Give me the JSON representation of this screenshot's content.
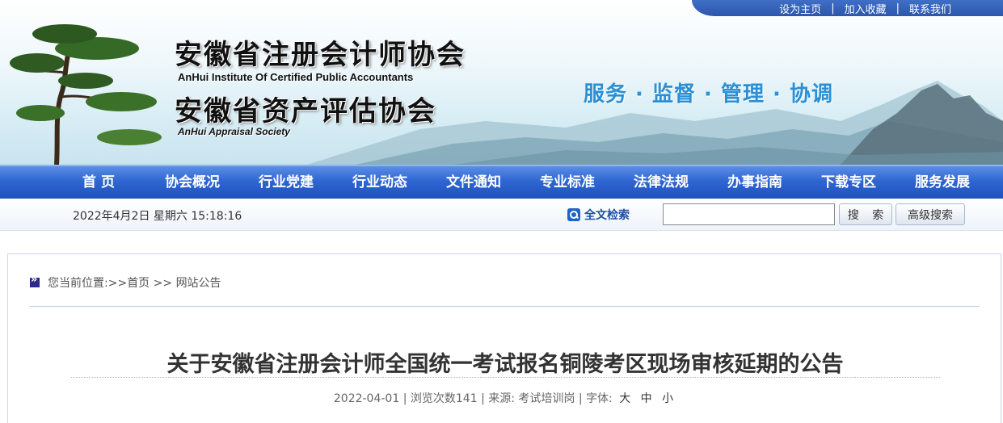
{
  "top_links": [
    "设为主页",
    "加入收藏",
    "联系我们"
  ],
  "banner": {
    "org_cn_1": "安徽省注册会计师协会",
    "org_en_1": "AnHui Institute Of Certified Public Accountants",
    "org_cn_2": "安徽省资产评估协会",
    "org_en_2": "AnHui Appraisal Society",
    "slogan": "服务 · 监督 · 管理 · 协调"
  },
  "nav": [
    "首 页",
    "协会概况",
    "行业党建",
    "行业动态",
    "文件通知",
    "专业标准",
    "法律法规",
    "办事指南",
    "下载专区",
    "服务发展"
  ],
  "infobar": {
    "datetime": "2022年4月2日 星期六 15:18:16",
    "fulltext_label": "全文检索",
    "search_value": "",
    "search_button": "搜 索",
    "advanced_button": "高级搜索"
  },
  "breadcrumb": {
    "prefix": "您当前位置:>>",
    "home": "首页",
    "separator": ">>",
    "current": "网站公告"
  },
  "article": {
    "title": "关于安徽省注册会计师全国统一考试报名铜陵考区现场审核延期的公告",
    "date": "2022-04-01",
    "views_label": "浏览次数",
    "views": "141",
    "source_label": "来源:",
    "source": "考试培训岗",
    "font_label": "字体:",
    "font_sizes": [
      "大",
      "中",
      "小"
    ]
  },
  "colors": {
    "nav_bg": "#2f66d2",
    "slogan": "#2a8fd4",
    "title": "#333333"
  }
}
